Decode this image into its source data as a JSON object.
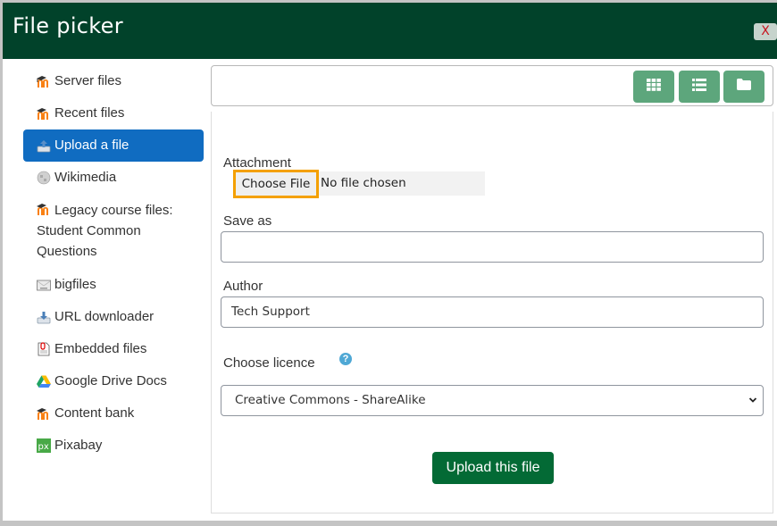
{
  "dialog": {
    "title": "File picker",
    "close_label": "X"
  },
  "sidebar": {
    "items": [
      {
        "label": "Server files",
        "icon": "moodle-icon",
        "active": false
      },
      {
        "label": "Recent files",
        "icon": "moodle-icon",
        "active": false
      },
      {
        "label": "Upload a file",
        "icon": "upload-icon",
        "active": true
      },
      {
        "label": "Wikimedia",
        "icon": "wikimedia-icon",
        "active": false
      },
      {
        "label": "Legacy course files: Student Common Questions",
        "icon": "moodle-icon",
        "active": false
      },
      {
        "label": "bigfiles",
        "icon": "filesystem-icon",
        "active": false
      },
      {
        "label": "URL downloader",
        "icon": "url-download-icon",
        "active": false
      },
      {
        "label": "Embedded files",
        "icon": "document-icon",
        "active": false
      },
      {
        "label": "Google Drive Docs",
        "icon": "google-drive-icon",
        "active": false
      },
      {
        "label": "Content bank",
        "icon": "moodle-icon",
        "active": false
      },
      {
        "label": "Pixabay",
        "icon": "pixabay-icon",
        "active": false
      }
    ]
  },
  "toolbar": {
    "buttons": [
      {
        "name": "grid-view",
        "icon": "grid-icon"
      },
      {
        "name": "list-view",
        "icon": "list-icon"
      },
      {
        "name": "tree-view",
        "icon": "folder-icon"
      }
    ]
  },
  "form": {
    "attachment_label": "Attachment",
    "choose_file_label": "Choose File",
    "no_file_text": "No file chosen",
    "save_as_label": "Save as",
    "save_as_value": "",
    "author_label": "Author",
    "author_value": "Tech Support",
    "licence_label": "Choose licence",
    "licence_help": "?",
    "licence_selected": "Creative Commons - ShareAlike",
    "upload_label": "Upload this file"
  },
  "colors": {
    "header_bg": "#01422a",
    "active_nav": "#106cc1",
    "toolbar_btn": "#5da67c",
    "primary_btn": "#036a35",
    "focus_outline": "#f4a000"
  }
}
